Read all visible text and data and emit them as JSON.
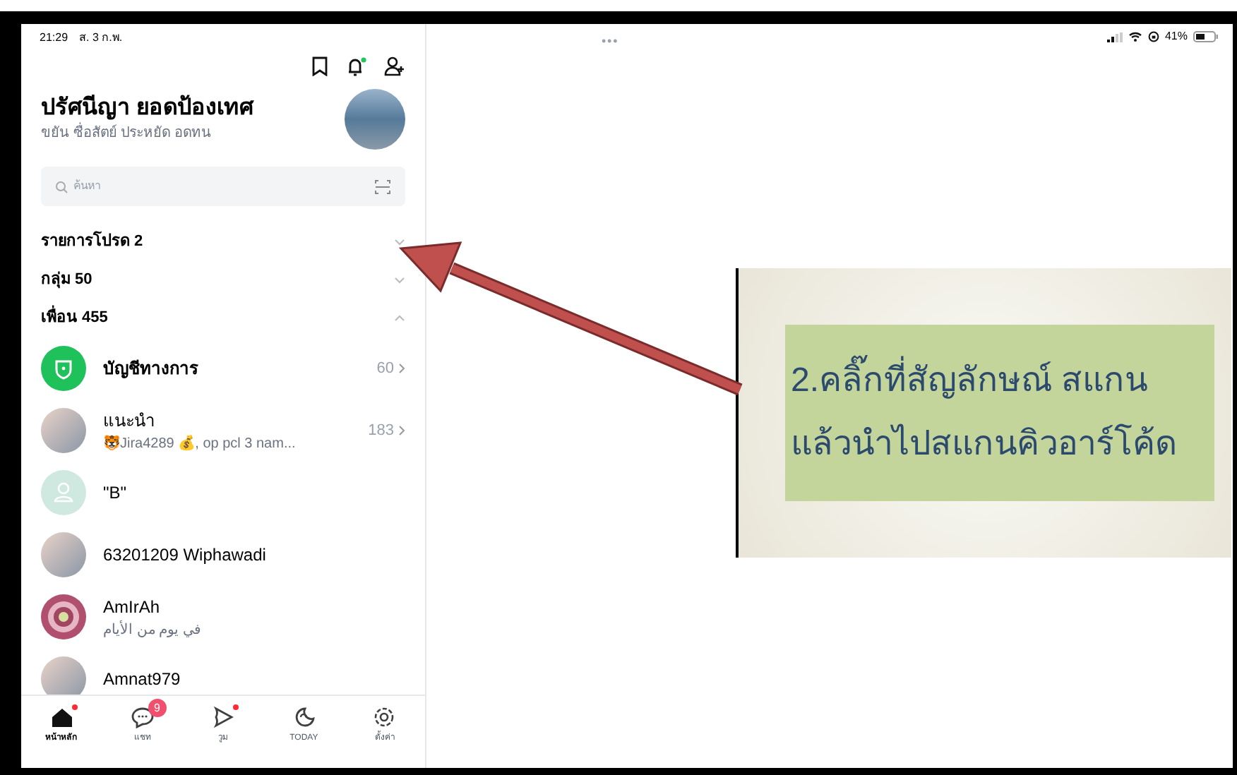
{
  "status_bar": {
    "time": "21:29",
    "date": "ส. 3 ก.พ.",
    "battery": "41%",
    "more": "•••"
  },
  "profile": {
    "name": "ปรัศนีญา ยอดป้องเทศ",
    "status": "ขยัน ซื่อสัตย์ ประหยัด อดทน"
  },
  "search": {
    "placeholder": "ค้นหา"
  },
  "sections": [
    {
      "label": "รายการโปรด 2",
      "expanded": false
    },
    {
      "label": "กลุ่ม 50",
      "expanded": false
    },
    {
      "label": "เพื่อน 455",
      "expanded": true
    }
  ],
  "friends": [
    {
      "kind": "official",
      "name": "บัญชีทางการ",
      "count": "60"
    },
    {
      "kind": "photo",
      "name": "แนะนำ",
      "subtitle": "🐯Jira4289 💰, op pcl 3 nam...",
      "count": "183"
    },
    {
      "kind": "blank",
      "name": "\"B\""
    },
    {
      "kind": "photo",
      "name": "63201209 Wiphawadi"
    },
    {
      "kind": "target",
      "name": "AmIrAh",
      "subtitle": "في يوم من الأيام"
    },
    {
      "kind": "photo",
      "name": "Amnat979"
    }
  ],
  "nav": [
    {
      "label": "หน้าหลัก",
      "selected": true,
      "dot": true
    },
    {
      "label": "แชท",
      "selected": false,
      "badge": "9"
    },
    {
      "label": "วูม",
      "selected": false,
      "dot": true
    },
    {
      "label": "TODAY",
      "selected": false
    },
    {
      "label": "ตั้งค่า",
      "selected": false
    }
  ],
  "callout": {
    "lines": [
      "2.คลิ๊กที่สัญลักษณ์ สแกน",
      "แล้วนำไปสแกนคิวอาร์โค้ด"
    ]
  }
}
